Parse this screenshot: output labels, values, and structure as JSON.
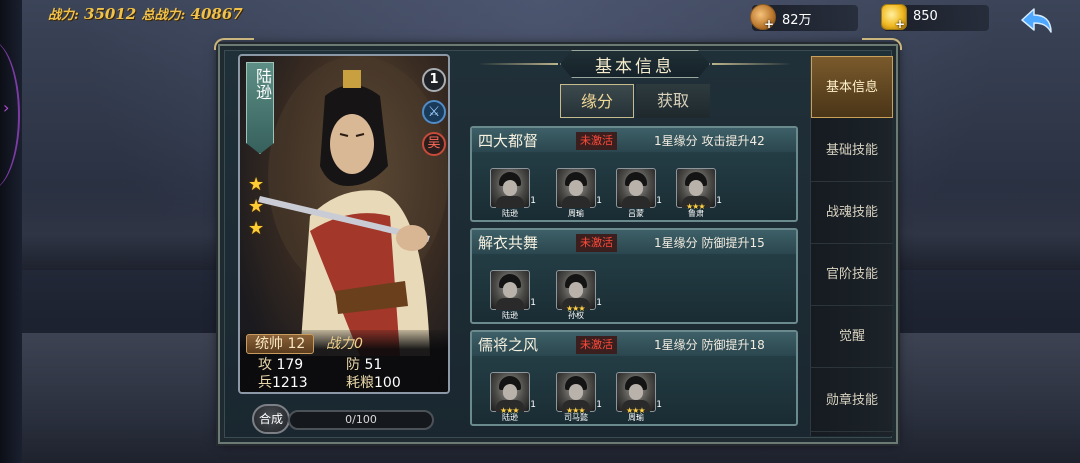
{
  "top": {
    "power_label": "战力:",
    "power_value": "35012",
    "total_power_label": "总战力:",
    "total_power_value": "40867",
    "copper": "82万",
    "gold": "850",
    "plus": "+"
  },
  "hero": {
    "name": "陆逊",
    "stars": 3,
    "star_glyph": "★",
    "number_badge": "1",
    "faction": "吴",
    "weapon_icon": "sword-icon",
    "command_label": "统帅",
    "command_value": "12",
    "soul_label": "战力",
    "soul_value": "0",
    "atk_label": "攻",
    "atk_value": "179",
    "def_label": "防",
    "def_value": "51",
    "troops_label": "兵",
    "troops_value": "1213",
    "grain_label": "耗粮",
    "grain_value": "100"
  },
  "synthesis": {
    "button": "合成",
    "progress_text": "0/100",
    "progress_fraction": 0
  },
  "panel": {
    "title": "基本信息",
    "tabs": [
      "缘分",
      "获取"
    ]
  },
  "fates": [
    {
      "title": "四大都督",
      "status": "未激活",
      "desc": "1星缘分 攻击提升42",
      "members": [
        "陆逊",
        "周瑜",
        "吕蒙",
        "鲁肃"
      ]
    },
    {
      "title": "解衣共舞",
      "status": "未激活",
      "desc": "1星缘分 防御提升15",
      "members": [
        "陆逊",
        "孙权"
      ]
    },
    {
      "title": "儒将之风",
      "status": "未激活",
      "desc": "1星缘分 防御提升18",
      "members": [
        "陆逊",
        "司马懿",
        "周瑜"
      ]
    }
  ],
  "member_level": "1",
  "member_stars": "★★★",
  "side_menu": [
    "基本信息",
    "基础技能",
    "战魂技能",
    "官阶技能",
    "觉醒",
    "勋章技能"
  ],
  "colors": {
    "accent_gold": "#f0c24a",
    "status_red": "#ff4a3a",
    "active_menu": "#7a5a2c"
  }
}
